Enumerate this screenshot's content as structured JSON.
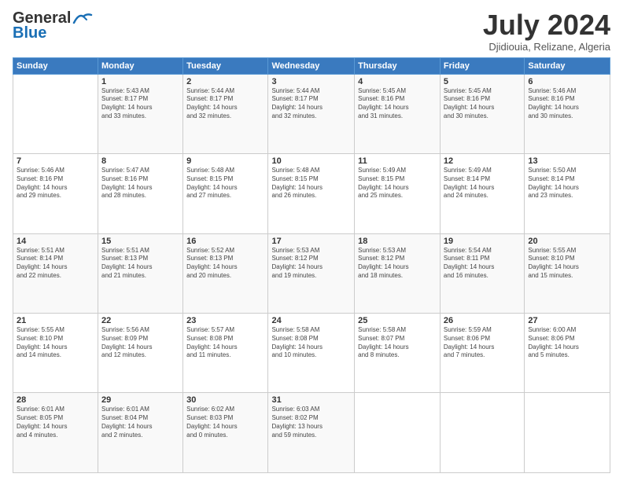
{
  "header": {
    "logo_line1": "General",
    "logo_line2": "Blue",
    "month": "July 2024",
    "location": "Djidiouia, Relizane, Algeria"
  },
  "weekdays": [
    "Sunday",
    "Monday",
    "Tuesday",
    "Wednesday",
    "Thursday",
    "Friday",
    "Saturday"
  ],
  "weeks": [
    [
      {
        "day": "",
        "info": ""
      },
      {
        "day": "1",
        "info": "Sunrise: 5:43 AM\nSunset: 8:17 PM\nDaylight: 14 hours\nand 33 minutes."
      },
      {
        "day": "2",
        "info": "Sunrise: 5:44 AM\nSunset: 8:17 PM\nDaylight: 14 hours\nand 32 minutes."
      },
      {
        "day": "3",
        "info": "Sunrise: 5:44 AM\nSunset: 8:17 PM\nDaylight: 14 hours\nand 32 minutes."
      },
      {
        "day": "4",
        "info": "Sunrise: 5:45 AM\nSunset: 8:16 PM\nDaylight: 14 hours\nand 31 minutes."
      },
      {
        "day": "5",
        "info": "Sunrise: 5:45 AM\nSunset: 8:16 PM\nDaylight: 14 hours\nand 30 minutes."
      },
      {
        "day": "6",
        "info": "Sunrise: 5:46 AM\nSunset: 8:16 PM\nDaylight: 14 hours\nand 30 minutes."
      }
    ],
    [
      {
        "day": "7",
        "info": "Sunrise: 5:46 AM\nSunset: 8:16 PM\nDaylight: 14 hours\nand 29 minutes."
      },
      {
        "day": "8",
        "info": "Sunrise: 5:47 AM\nSunset: 8:16 PM\nDaylight: 14 hours\nand 28 minutes."
      },
      {
        "day": "9",
        "info": "Sunrise: 5:48 AM\nSunset: 8:15 PM\nDaylight: 14 hours\nand 27 minutes."
      },
      {
        "day": "10",
        "info": "Sunrise: 5:48 AM\nSunset: 8:15 PM\nDaylight: 14 hours\nand 26 minutes."
      },
      {
        "day": "11",
        "info": "Sunrise: 5:49 AM\nSunset: 8:15 PM\nDaylight: 14 hours\nand 25 minutes."
      },
      {
        "day": "12",
        "info": "Sunrise: 5:49 AM\nSunset: 8:14 PM\nDaylight: 14 hours\nand 24 minutes."
      },
      {
        "day": "13",
        "info": "Sunrise: 5:50 AM\nSunset: 8:14 PM\nDaylight: 14 hours\nand 23 minutes."
      }
    ],
    [
      {
        "day": "14",
        "info": "Sunrise: 5:51 AM\nSunset: 8:14 PM\nDaylight: 14 hours\nand 22 minutes."
      },
      {
        "day": "15",
        "info": "Sunrise: 5:51 AM\nSunset: 8:13 PM\nDaylight: 14 hours\nand 21 minutes."
      },
      {
        "day": "16",
        "info": "Sunrise: 5:52 AM\nSunset: 8:13 PM\nDaylight: 14 hours\nand 20 minutes."
      },
      {
        "day": "17",
        "info": "Sunrise: 5:53 AM\nSunset: 8:12 PM\nDaylight: 14 hours\nand 19 minutes."
      },
      {
        "day": "18",
        "info": "Sunrise: 5:53 AM\nSunset: 8:12 PM\nDaylight: 14 hours\nand 18 minutes."
      },
      {
        "day": "19",
        "info": "Sunrise: 5:54 AM\nSunset: 8:11 PM\nDaylight: 14 hours\nand 16 minutes."
      },
      {
        "day": "20",
        "info": "Sunrise: 5:55 AM\nSunset: 8:10 PM\nDaylight: 14 hours\nand 15 minutes."
      }
    ],
    [
      {
        "day": "21",
        "info": "Sunrise: 5:55 AM\nSunset: 8:10 PM\nDaylight: 14 hours\nand 14 minutes."
      },
      {
        "day": "22",
        "info": "Sunrise: 5:56 AM\nSunset: 8:09 PM\nDaylight: 14 hours\nand 12 minutes."
      },
      {
        "day": "23",
        "info": "Sunrise: 5:57 AM\nSunset: 8:08 PM\nDaylight: 14 hours\nand 11 minutes."
      },
      {
        "day": "24",
        "info": "Sunrise: 5:58 AM\nSunset: 8:08 PM\nDaylight: 14 hours\nand 10 minutes."
      },
      {
        "day": "25",
        "info": "Sunrise: 5:58 AM\nSunset: 8:07 PM\nDaylight: 14 hours\nand 8 minutes."
      },
      {
        "day": "26",
        "info": "Sunrise: 5:59 AM\nSunset: 8:06 PM\nDaylight: 14 hours\nand 7 minutes."
      },
      {
        "day": "27",
        "info": "Sunrise: 6:00 AM\nSunset: 8:06 PM\nDaylight: 14 hours\nand 5 minutes."
      }
    ],
    [
      {
        "day": "28",
        "info": "Sunrise: 6:01 AM\nSunset: 8:05 PM\nDaylight: 14 hours\nand 4 minutes."
      },
      {
        "day": "29",
        "info": "Sunrise: 6:01 AM\nSunset: 8:04 PM\nDaylight: 14 hours\nand 2 minutes."
      },
      {
        "day": "30",
        "info": "Sunrise: 6:02 AM\nSunset: 8:03 PM\nDaylight: 14 hours\nand 0 minutes."
      },
      {
        "day": "31",
        "info": "Sunrise: 6:03 AM\nSunset: 8:02 PM\nDaylight: 13 hours\nand 59 minutes."
      },
      {
        "day": "",
        "info": ""
      },
      {
        "day": "",
        "info": ""
      },
      {
        "day": "",
        "info": ""
      }
    ]
  ]
}
